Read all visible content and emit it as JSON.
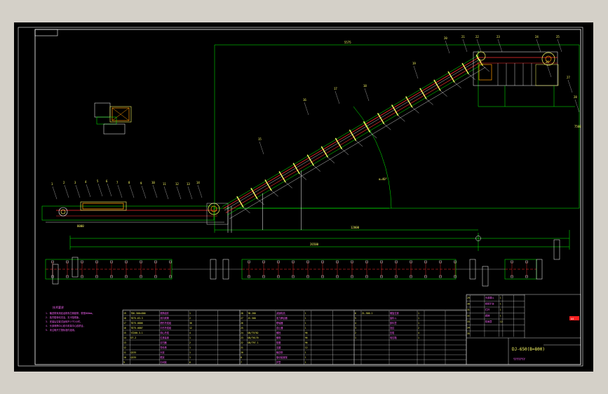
{
  "drawing": {
    "title_block_name": "DJ-650(B=800)",
    "title_block_code": "YYYYYYY",
    "red_stamp": "A4",
    "tech_notes_title": "技术要求",
    "tech_notes": [
      "1. 输送带采用尼龙帆布芯橡胶带，带宽800mm。",
      "2. 各托辊转动灵活，无卡阻现象。",
      "3. 安装后空载试运转不少于2小时。",
      "4. 头部滚筒中心线与机架中心线重合。",
      "5. 未注明尺寸按标准件选用。"
    ],
    "dims": {
      "top_span": "5575",
      "left_span": "8000",
      "total_length": "26500",
      "mid_span": "12000",
      "height": "7560",
      "angle": "α=40°"
    },
    "balloons": [
      "1",
      "2",
      "3",
      "4",
      "5",
      "6",
      "7",
      "8",
      "9",
      "10",
      "11",
      "12",
      "13",
      "14",
      "15",
      "16",
      "17",
      "18",
      "19",
      "20",
      "21",
      "22",
      "23",
      "24",
      "25",
      "26",
      "27",
      "28"
    ]
  },
  "bom": {
    "col1": [
      [
        "19",
        "TDK-500×800",
        "滚筒组件",
        "1",
        "",
        ""
      ],
      [
        "18",
        "TD75-63-3",
        "改向滚筒",
        "2",
        "",
        ""
      ],
      [
        "17",
        "TD75-0806",
        "槽形托辊组",
        "36",
        "",
        ""
      ],
      [
        "16",
        "TD75-0807",
        "平形托辊组",
        "12",
        "",
        ""
      ],
      [
        "15",
        "YZ200-3-1",
        "调心托辊",
        "4",
        "",
        ""
      ],
      [
        "14",
        "DT-2",
        "拉紧装置",
        "1",
        "",
        ""
      ],
      [
        "13",
        "",
        "清扫器",
        "2",
        "",
        ""
      ],
      [
        "12",
        "",
        "导料槽",
        "1",
        "",
        ""
      ],
      [
        "11",
        "Q235",
        "头架",
        "1",
        "",
        ""
      ],
      [
        "10",
        "Q235",
        "尾架",
        "1",
        "",
        ""
      ],
      [
        "9",
        "",
        "中间架",
        "6",
        "",
        ""
      ]
    ],
    "col2": [
      [
        "28",
        "YB-200",
        "减速电机",
        "1",
        "",
        ""
      ],
      [
        "27",
        "JS-500",
        "液力耦合器",
        "1",
        "",
        ""
      ],
      [
        "26",
        "",
        "联轴器",
        "1",
        "",
        ""
      ],
      [
        "25",
        "",
        "逆止器",
        "1",
        "",
        ""
      ],
      [
        "24",
        "GB/T5782",
        "螺栓",
        "96",
        "",
        ""
      ],
      [
        "23",
        "GB/T6170",
        "螺母",
        "96",
        "",
        ""
      ],
      [
        "22",
        "GB/T97.1",
        "垫圈",
        "96",
        "",
        ""
      ],
      [
        "21",
        "",
        "支腿",
        "12",
        "",
        ""
      ],
      [
        "20",
        "",
        "输送带",
        "1",
        "",
        ""
      ],
      [
        "8",
        "",
        "驱动装置架",
        "1",
        "",
        ""
      ],
      [
        "7",
        "",
        "护罩",
        "1",
        "",
        ""
      ]
    ],
    "col3": [
      [
        "6",
        "ZL-500-1",
        "螺旋拉紧",
        "1",
        "",
        ""
      ],
      [
        "5",
        "",
        "接料斗",
        "1",
        "",
        ""
      ],
      [
        "4",
        "",
        "卸料罩",
        "1",
        "",
        ""
      ],
      [
        "3",
        "",
        "挡边",
        "2",
        "",
        ""
      ],
      [
        "2",
        "",
        "压辊",
        "4",
        "",
        ""
      ],
      [
        "1",
        "",
        "电控箱",
        "1",
        "",
        ""
      ],
      [
        "",
        "",
        "",
        "",
        "",
        ""
      ],
      [
        "",
        "",
        "",
        "",
        "",
        ""
      ],
      [
        "",
        "",
        "",
        "",
        "",
        ""
      ],
      [
        "",
        "",
        "",
        "",
        "",
        ""
      ],
      [
        "",
        "",
        "",
        "",
        "",
        ""
      ]
    ],
    "col4": [
      [
        "29",
        "",
        "头部漏斗",
        "1",
        "",
        ""
      ],
      [
        "30",
        "",
        "检修平台",
        "1",
        "",
        ""
      ],
      [
        "31",
        "",
        "栏杆",
        "1",
        "",
        ""
      ],
      [
        "32",
        "",
        "爬梯",
        "1",
        "",
        ""
      ],
      [
        "33",
        "",
        "防雨罩",
        "12",
        "",
        ""
      ],
      [
        "34",
        "",
        "",
        "",
        "",
        ""
      ],
      [
        "35",
        "",
        "",
        "",
        "",
        ""
      ]
    ]
  }
}
